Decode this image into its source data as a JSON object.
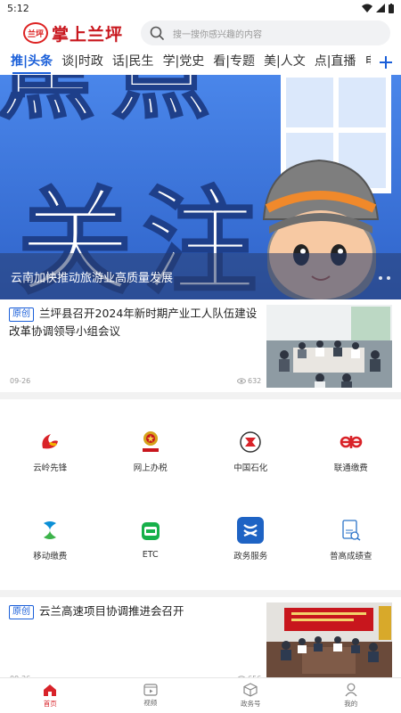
{
  "status_bar": {
    "time": "5:12"
  },
  "header": {
    "logo_seal": "兰坪",
    "logo_text": "掌上兰坪",
    "search_placeholder": "搜一搜你感兴趣的内容"
  },
  "tabs": [
    {
      "label": "推|头条",
      "active": true
    },
    {
      "label": "谈|时政",
      "active": false
    },
    {
      "label": "话|民生",
      "active": false
    },
    {
      "label": "学|党史",
      "active": false
    },
    {
      "label": "看|专题",
      "active": false
    },
    {
      "label": "美|人文",
      "active": false
    },
    {
      "label": "点|直播",
      "active": false
    },
    {
      "label": "电视",
      "active": false
    }
  ],
  "tab_add_icon": "plus-icon",
  "banner": {
    "headline_chars": [
      "焦",
      "点",
      "关",
      "注"
    ],
    "caption": "云南加快推动旅游业高质量发展",
    "dots": 2
  },
  "news": [
    {
      "tag": "原创",
      "title": "兰坪县召开2024年新时期产业工人队伍建设改革协调领导小组会议",
      "date": "09-26",
      "views": "632"
    },
    {
      "tag": "原创",
      "title": "云兰高速项目协调推进会召开",
      "date": "09-26",
      "views": "656"
    }
  ],
  "services": [
    {
      "label": "云岭先锋",
      "icon": "yunling-pioneer-icon"
    },
    {
      "label": "网上办税",
      "icon": "tax-emblem-icon"
    },
    {
      "label": "中国石化",
      "icon": "sinopec-icon"
    },
    {
      "label": "联通缴费",
      "icon": "unicom-icon"
    },
    {
      "label": "移动缴费",
      "icon": "china-mobile-icon"
    },
    {
      "label": "ETC",
      "icon": "etc-icon"
    },
    {
      "label": "政务服务",
      "icon": "gov-service-icon"
    },
    {
      "label": "普高成绩查",
      "icon": "score-query-icon"
    }
  ],
  "bottom_nav": [
    {
      "label": "首页",
      "icon": "home-icon",
      "active": true
    },
    {
      "label": "视频",
      "icon": "video-icon",
      "active": false
    },
    {
      "label": "政务号",
      "icon": "box-icon",
      "active": false
    },
    {
      "label": "我的",
      "icon": "user-icon",
      "active": false
    }
  ],
  "colors": {
    "accent_blue": "#1a5fd9",
    "brand_red": "#d8232a"
  }
}
